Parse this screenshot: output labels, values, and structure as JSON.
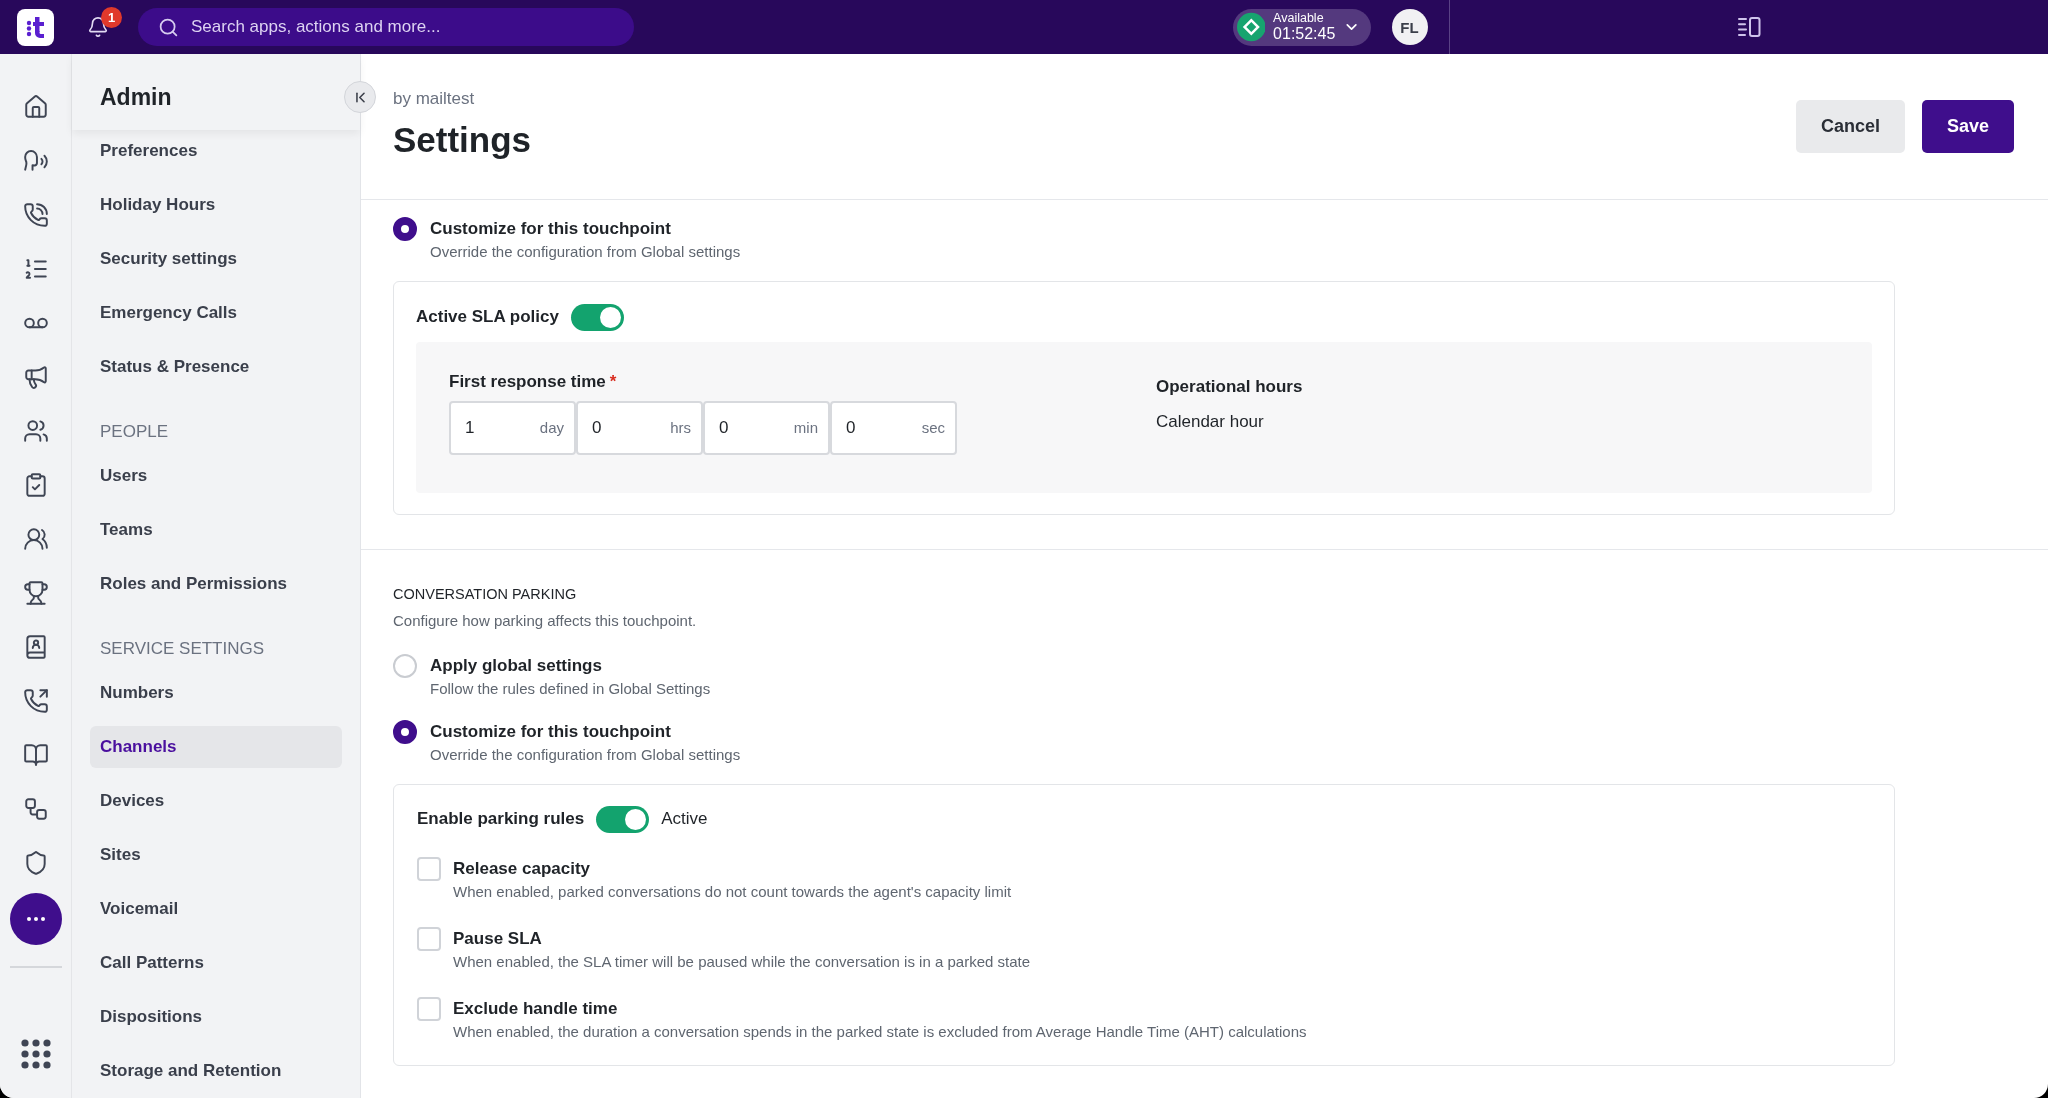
{
  "top_bar": {
    "notifications": {
      "count": "1"
    },
    "search": {
      "placeholder": "Search apps, actions and more..."
    },
    "status": {
      "label": "Available",
      "timer": "01:52:45"
    },
    "avatar": {
      "initials": "FL"
    }
  },
  "sidebar": {
    "title": "Admin",
    "sections": [
      {
        "items": [
          {
            "label": "Preferences",
            "selected": false
          },
          {
            "label": "Holiday Hours",
            "selected": false
          },
          {
            "label": "Security settings",
            "selected": false
          },
          {
            "label": "Emergency Calls",
            "selected": false
          },
          {
            "label": "Status & Presence",
            "selected": false
          }
        ]
      },
      {
        "heading": "PEOPLE",
        "items": [
          {
            "label": "Users",
            "selected": false
          },
          {
            "label": "Teams",
            "selected": false
          },
          {
            "label": "Roles and Permissions",
            "selected": false
          }
        ]
      },
      {
        "heading": "SERVICE SETTINGS",
        "items": [
          {
            "label": "Numbers",
            "selected": false
          },
          {
            "label": "Channels",
            "selected": true
          },
          {
            "label": "Devices",
            "selected": false
          },
          {
            "label": "Sites",
            "selected": false
          },
          {
            "label": "Voicemail",
            "selected": false
          },
          {
            "label": "Call Patterns",
            "selected": false
          },
          {
            "label": "Dispositions",
            "selected": false
          },
          {
            "label": "Storage and Retention",
            "selected": false
          }
        ]
      }
    ]
  },
  "header": {
    "subtitle": "by mailtest",
    "title": "Settings",
    "buttons": [
      {
        "label": "Cancel",
        "kind": "secondary"
      },
      {
        "label": "Save",
        "kind": "primary"
      }
    ]
  },
  "sla": {
    "options": [
      {
        "label": "Customize for this touchpoint",
        "description": "Override the configuration from Global settings",
        "selected": true
      }
    ],
    "policy": {
      "label": "Active SLA policy",
      "on": true
    },
    "first_response": {
      "label": "First response time",
      "required_mark": "*",
      "fields": [
        {
          "value": "1",
          "unit": "day"
        },
        {
          "value": "0",
          "unit": "hrs"
        },
        {
          "value": "0",
          "unit": "min"
        },
        {
          "value": "0",
          "unit": "sec"
        }
      ]
    },
    "operational_hours": {
      "label": "Operational hours",
      "value": "Calendar hour"
    }
  },
  "parking": {
    "heading": "CONVERSATION PARKING",
    "description": "Configure how parking affects this touchpoint.",
    "options": [
      {
        "label": "Apply global settings",
        "description": "Follow the rules defined in Global Settings",
        "selected": false
      },
      {
        "label": "Customize for this touchpoint",
        "description": "Override the configuration from Global settings",
        "selected": true
      }
    ],
    "rules": {
      "label": "Enable parking rules",
      "on": true,
      "status": "Active"
    },
    "checks": [
      {
        "label": "Release capacity",
        "description": "When enabled, parked conversations do not count towards the agent's capacity limit",
        "checked": false
      },
      {
        "label": "Pause SLA",
        "description": "When enabled, the SLA timer will be paused while the conversation is in a parked state",
        "checked": false
      },
      {
        "label": "Exclude handle time",
        "description": "When enabled, the duration a conversation spends in the parked state is excluded from Average Handle Time (AHT) calculations",
        "checked": false
      }
    ]
  }
}
